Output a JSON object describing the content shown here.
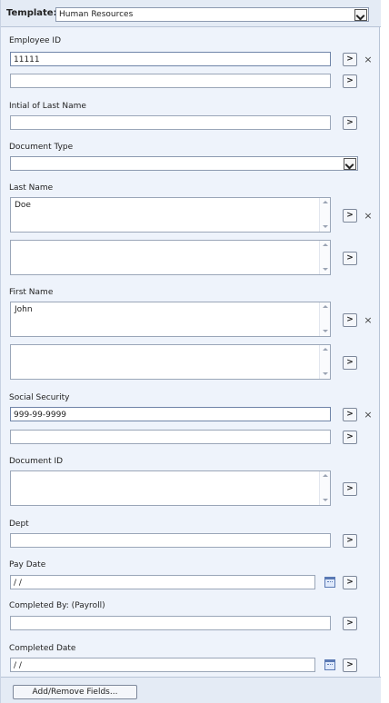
{
  "template": {
    "label": "Template:",
    "value": "Human Resources"
  },
  "fields": {
    "employee_id": {
      "label": "Employee ID",
      "value1": "11111",
      "value2": ""
    },
    "initial_last_name": {
      "label": "Intial of Last Name",
      "value": ""
    },
    "document_type": {
      "label": "Document Type",
      "value": ""
    },
    "last_name": {
      "label": "Last Name",
      "value1": "Doe",
      "value2": ""
    },
    "first_name": {
      "label": "First Name",
      "value1": "John",
      "value2": ""
    },
    "social_security": {
      "label": "Social Security",
      "value1": "999-99-9999",
      "value2": ""
    },
    "document_id": {
      "label": "Document ID",
      "value": ""
    },
    "dept": {
      "label": "Dept",
      "value": ""
    },
    "pay_date": {
      "label": "Pay Date",
      "value": " /  /"
    },
    "completed_by": {
      "label": "Completed By: (Payroll)",
      "value": ""
    },
    "completed_date": {
      "label": "Completed Date",
      "value": " /  /"
    }
  },
  "buttons": {
    "go": ">",
    "remove": "×",
    "add_remove": "Add/Remove Fields..."
  },
  "icons": {
    "dropdown": "chevron-down-icon",
    "calendar": "calendar-icon",
    "scroll_up": "scroll-up-icon",
    "scroll_down": "scroll-down-icon"
  }
}
